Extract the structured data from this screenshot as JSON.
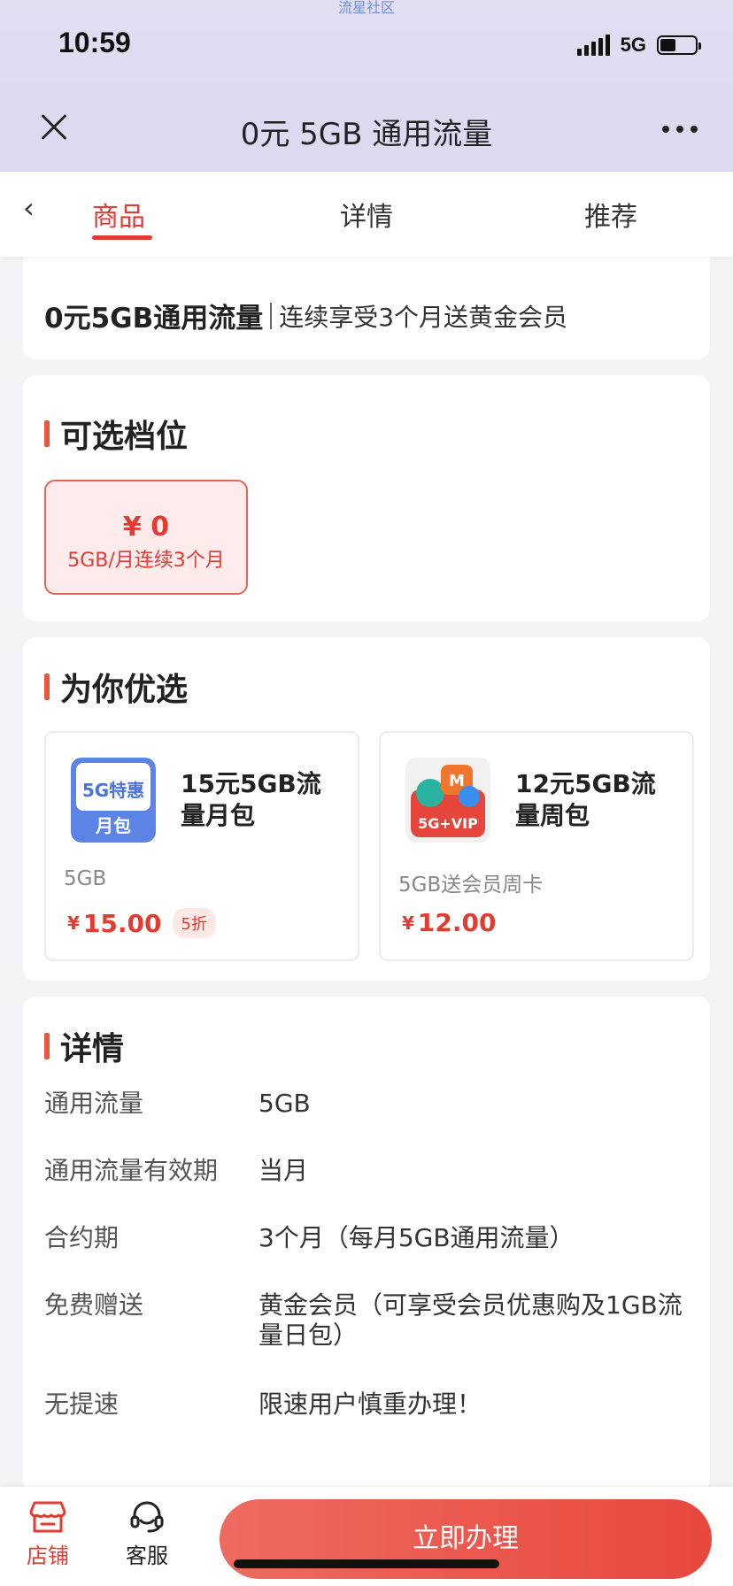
{
  "watermark": "流星社区",
  "status_bar": {
    "time": "10:59",
    "network": "5G"
  },
  "nav": {
    "title": "0元 5GB 通用流量"
  },
  "tabs": [
    {
      "label": "商品",
      "active": true
    },
    {
      "label": "详情",
      "active": false
    },
    {
      "label": "推荐",
      "active": false
    }
  ],
  "product": {
    "name": "0元5GB通用流量",
    "subtitle": "连续享受3个月送黄金会员"
  },
  "tiers": {
    "title": "可选档位",
    "items": [
      {
        "price": "¥ 0",
        "desc": "5GB/月连续3个月",
        "selected": true
      }
    ]
  },
  "recommend": {
    "title": "为你优选",
    "items": [
      {
        "title": "15元5GB流量月包",
        "icon_text_top": "5G特惠",
        "icon_text_bottom": "月包",
        "sub": "5GB",
        "yen": "¥",
        "price": "15.00",
        "discount": "5折"
      },
      {
        "title": "12元5GB流量周包",
        "icon_text": "5G+VIP",
        "sub": "5GB送会员周卡",
        "yen": "¥",
        "price": "12.00"
      }
    ]
  },
  "details": {
    "title": "详情",
    "rows": [
      {
        "key": "通用流量",
        "value": "5GB"
      },
      {
        "key": "通用流量有效期",
        "value": "当月"
      },
      {
        "key": "合约期",
        "value": "3个月（每月5GB通用流量）"
      },
      {
        "key": "免费赠送",
        "value": "黄金会员（可享受会员优惠购及1GB流量日包）"
      },
      {
        "key": "无提速",
        "value": "限速用户慎重办理！"
      }
    ]
  },
  "bottom_bar": {
    "shop_label": "店铺",
    "service_label": "客服",
    "cta_label": "立即办理"
  },
  "colors": {
    "accent": "#e23b32",
    "header_bg": "#e3def2",
    "cta": "#ea5046"
  }
}
